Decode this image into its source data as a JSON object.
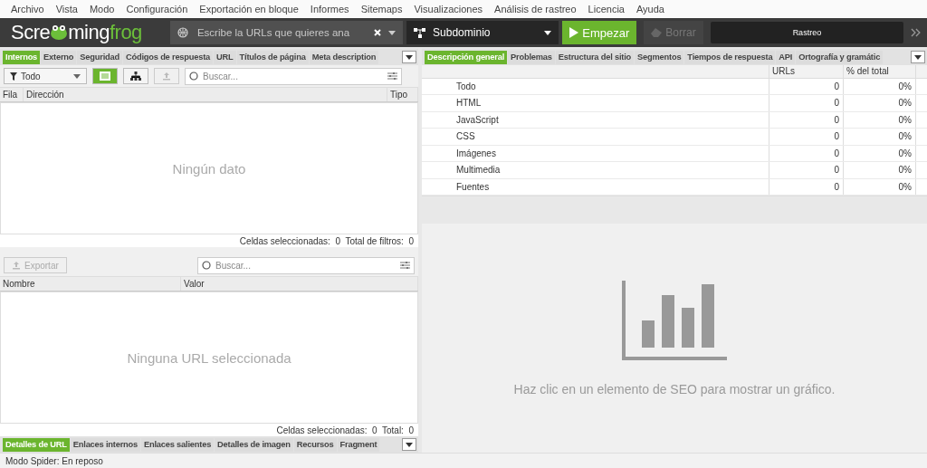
{
  "menu": [
    "Archivo",
    "Vista",
    "Modo",
    "Configuración",
    "Exportación en bloque",
    "Informes",
    "Sitemaps",
    "Visualizaciones",
    "Análisis de rastreo",
    "Licencia",
    "Ayuda"
  ],
  "toolbar": {
    "logo": {
      "before": "Scre",
      "after": "ming",
      "accent": "frog"
    },
    "url_field": {
      "placeholder": "Escribe la URLs que quieres ana"
    },
    "mode": "Subdominio",
    "start": "Empezar",
    "clear": {
      "label": "Borrar",
      "disabled": true
    },
    "progress": {
      "label": "Rastreo",
      "level": 0
    }
  },
  "left_tabs": [
    {
      "label": "Internos",
      "selected": true
    },
    {
      "label": "Externo",
      "selected": false
    },
    {
      "label": "Seguridad",
      "selected": false
    },
    {
      "label": "Códigos de respuesta",
      "selected": false
    },
    {
      "label": "URL",
      "selected": false
    },
    {
      "label": "Títulos de página",
      "selected": false
    },
    {
      "label": "Meta description",
      "selected": false
    }
  ],
  "filter": {
    "value": "Todo",
    "views": [
      {
        "kind": "list",
        "selected": true
      },
      {
        "kind": "tree",
        "selected": false
      }
    ],
    "search_placeholder": "Buscar..."
  },
  "main_table": {
    "columns": [
      "Fila",
      "Dirección",
      "Tipo"
    ],
    "empty": "Ningún dato",
    "status": "Celdas seleccionadas:  0  Total de filtros:  0"
  },
  "details": {
    "export": {
      "label": "Exportar",
      "disabled": true
    },
    "search_placeholder": "Buscar...",
    "columns": [
      "Nombre",
      "Valor"
    ],
    "empty": "Ninguna URL seleccionada",
    "status": "Celdas seleccionadas:  0  Total:  0"
  },
  "bottom_tabs": [
    {
      "label": "Detalles de URL",
      "selected": true
    },
    {
      "label": "Enlaces internos",
      "selected": false
    },
    {
      "label": "Enlaces salientes",
      "selected": false
    },
    {
      "label": "Detalles de imagen",
      "selected": false
    },
    {
      "label": "Recursos",
      "selected": false
    },
    {
      "label": "Fragment",
      "selected": false
    }
  ],
  "right_tabs": [
    {
      "label": "Descripción general",
      "selected": true
    },
    {
      "label": "Problemas",
      "selected": false
    },
    {
      "label": "Estructura del sitio",
      "selected": false
    },
    {
      "label": "Segmentos",
      "selected": false
    },
    {
      "label": "Tiempos de respuesta",
      "selected": false
    },
    {
      "label": "API",
      "selected": false
    },
    {
      "label": "Ortografía y gramátic",
      "selected": false
    }
  ],
  "overview": {
    "columns": [
      "URLs",
      "% del total"
    ],
    "rows": [
      {
        "name": "Todo",
        "urls": "0",
        "pct": "0%"
      },
      {
        "name": "HTML",
        "urls": "0",
        "pct": "0%"
      },
      {
        "name": "JavaScript",
        "urls": "0",
        "pct": "0%"
      },
      {
        "name": "CSS",
        "urls": "0",
        "pct": "0%"
      },
      {
        "name": "Imágenes",
        "urls": "0",
        "pct": "0%"
      },
      {
        "name": "Multimedia",
        "urls": "0",
        "pct": "0%"
      },
      {
        "name": "Fuentes",
        "urls": "0",
        "pct": "0%"
      }
    ]
  },
  "chart_hint": "Haz clic en un elemento de SEO para mostrar un gráfico.",
  "status_bar": "Modo Spider: En reposo"
}
